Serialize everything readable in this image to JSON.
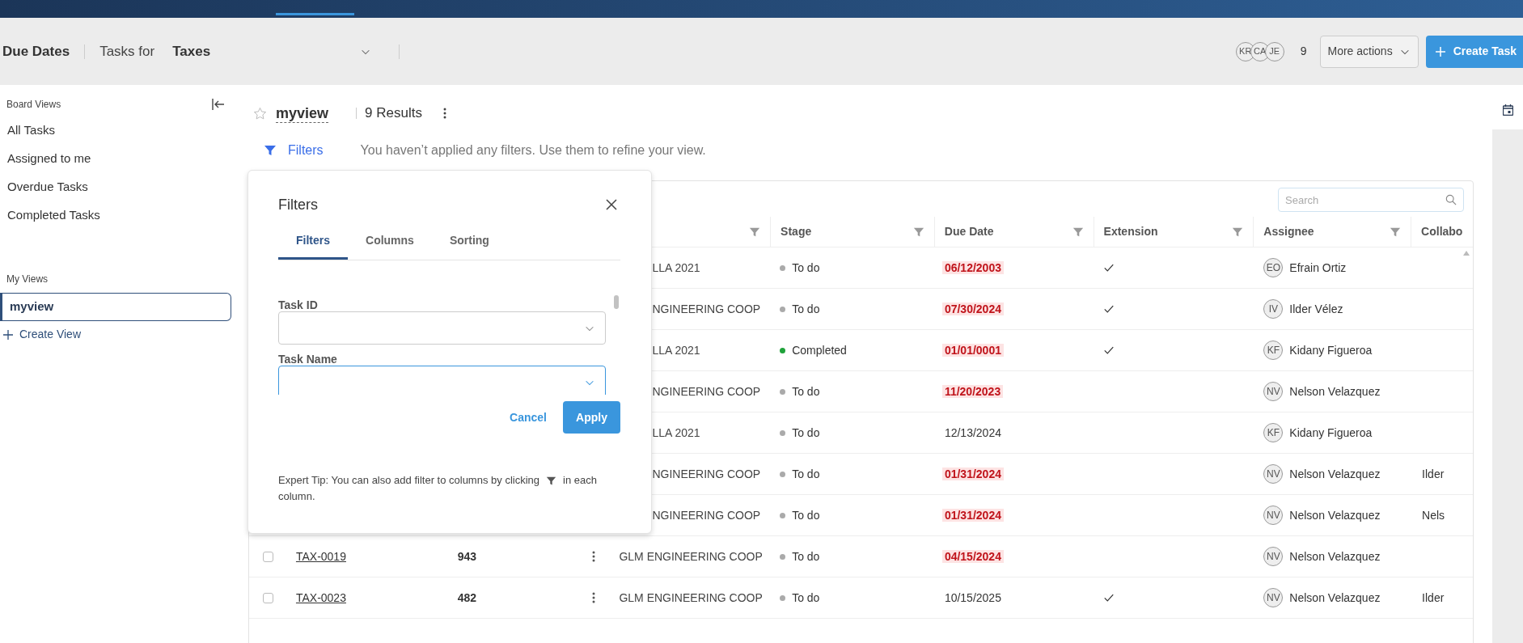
{
  "header": {
    "title": "Due Dates",
    "tasks_for_label": "Tasks for",
    "project": "Taxes",
    "avatars": [
      "KR",
      "CA",
      "JE"
    ],
    "member_count": "9",
    "more_actions": "More actions",
    "create_task": "Create Task"
  },
  "sidebar": {
    "board_views_label": "Board Views",
    "board_views": [
      {
        "label": "All Tasks",
        "selected": false
      },
      {
        "label": "Assigned to me",
        "selected": false
      },
      {
        "label": "Overdue Tasks",
        "selected": false
      },
      {
        "label": "Completed Tasks",
        "selected": false
      }
    ],
    "my_views_label": "My Views",
    "my_views": [
      {
        "label": "myview",
        "selected": true
      }
    ],
    "create_view": "Create View"
  },
  "view": {
    "name": "myview",
    "favorite": false,
    "results": "9 Results",
    "filters_label": "Filters",
    "filters_message": "You haven’t applied any filters. Use them to refine your view."
  },
  "table": {
    "search_placeholder": "Search",
    "columns": [
      {
        "label": "Stage"
      },
      {
        "label": "Due Date"
      },
      {
        "label": "Extension"
      },
      {
        "label": "Assignee"
      },
      {
        "label": "Collabo"
      }
    ],
    "rows": [
      {
        "client": "LLA 2021",
        "stage": "To do",
        "color": "#aaaaaa",
        "due": "06/12/2003",
        "overdue": true,
        "extension": true,
        "assignee_initials": "EO",
        "assignee": "Efrain Ortiz"
      },
      {
        "client": "NGINEERING COOP",
        "stage": "To do",
        "color": "#aaaaaa",
        "due": "07/30/2024",
        "overdue": true,
        "extension": true,
        "assignee_initials": "IV",
        "assignee": "Ilder Vélez"
      },
      {
        "client": "LLA 2021",
        "stage": "Completed",
        "color": "#1fa23a",
        "due": "01/01/0001",
        "overdue": true,
        "extension": true,
        "assignee_initials": "KF",
        "assignee": "Kidany Figueroa"
      },
      {
        "client": "NGINEERING COOP",
        "stage": "To do",
        "color": "#aaaaaa",
        "due": "11/20/2023",
        "overdue": true,
        "extension": false,
        "assignee_initials": "NV",
        "assignee": "Nelson Velazquez"
      },
      {
        "client": "LLA 2021",
        "stage": "To do",
        "color": "#aaaaaa",
        "due": "12/13/2024",
        "overdue": false,
        "extension": false,
        "assignee_initials": "KF",
        "assignee": "Kidany Figueroa"
      },
      {
        "client": "NGINEERING COOP",
        "stage": "To do",
        "color": "#aaaaaa",
        "due": "01/31/2024",
        "overdue": true,
        "extension": false,
        "assignee_initials": "NV",
        "assignee": "Nelson Velazquez",
        "collaborator": "Ilder"
      },
      {
        "client": "NGINEERING COOP",
        "stage": "To do",
        "color": "#aaaaaa",
        "due": "01/31/2024",
        "overdue": true,
        "extension": false,
        "assignee_initials": "NV",
        "assignee": "Nelson Velazquez",
        "collaborator": "Nels"
      },
      {
        "checked": false,
        "task_id": "TAX-0019",
        "number": "943",
        "client": "GLM ENGINEERING COOP",
        "stage": "To do",
        "color": "#aaaaaa",
        "due": "04/15/2024",
        "overdue": true,
        "extension": false,
        "assignee_initials": "NV",
        "assignee": "Nelson Velazquez"
      },
      {
        "checked": false,
        "task_id": "TAX-0023",
        "number": "482",
        "client": "GLM ENGINEERING COOP",
        "stage": "To do",
        "color": "#aaaaaa",
        "due": "10/15/2025",
        "overdue": false,
        "extension": true,
        "assignee_initials": "NV",
        "assignee": "Nelson Velazquez",
        "collaborator": "Ilder"
      }
    ]
  },
  "filters_panel": {
    "title": "Filters",
    "tabs": [
      {
        "label": "Filters",
        "selected": true
      },
      {
        "label": "Columns",
        "selected": false
      },
      {
        "label": "Sorting",
        "selected": false
      }
    ],
    "fields": [
      {
        "label": "Task ID",
        "focused": false
      },
      {
        "label": "Task Name",
        "focused": true
      }
    ],
    "cancel": "Cancel",
    "apply": "Apply",
    "tip": [
      "Expert Tip: You can also add filter to columns by clicking",
      "in each",
      "column."
    ]
  }
}
